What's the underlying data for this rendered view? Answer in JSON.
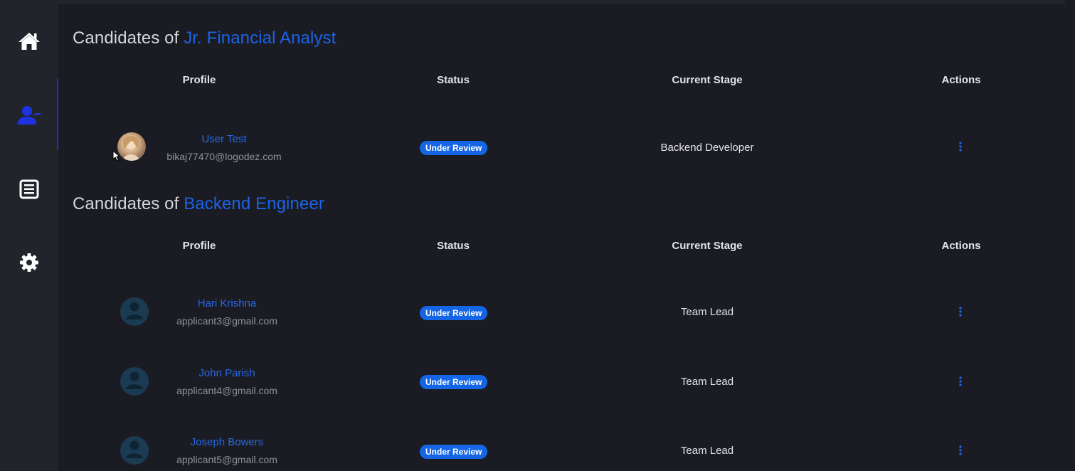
{
  "sidebar": {
    "items": [
      {
        "icon": "home-icon",
        "active": false
      },
      {
        "icon": "candidates-icon",
        "active": true
      },
      {
        "icon": "document-icon",
        "active": false
      },
      {
        "icon": "gear-icon",
        "active": false
      }
    ]
  },
  "colors": {
    "accent": "#1a63e8",
    "badge": "#1566e6",
    "background": "#1b1c23",
    "sidebar": "#22242c"
  },
  "columns": {
    "profile": "Profile",
    "status": "Status",
    "stage": "Current Stage",
    "actions": "Actions"
  },
  "sections": [
    {
      "title_prefix": "Candidates of",
      "job": "Jr. Financial Analyst",
      "candidates": [
        {
          "name": "User Test",
          "email": "bikaj77470@logodez.com",
          "status": "Under Review",
          "stage": "Backend Developer",
          "avatar": "photo"
        }
      ]
    },
    {
      "title_prefix": "Candidates of",
      "job": "Backend Engineer",
      "candidates": [
        {
          "name": "Hari Krishna",
          "email": "applicant3@gmail.com",
          "status": "Under Review",
          "stage": "Team Lead",
          "avatar": "placeholder"
        },
        {
          "name": "John Parish",
          "email": "applicant4@gmail.com",
          "status": "Under Review",
          "stage": "Team Lead",
          "avatar": "placeholder"
        },
        {
          "name": "Joseph Bowers",
          "email": "applicant5@gmail.com",
          "status": "Under Review",
          "stage": "Team Lead",
          "avatar": "placeholder"
        }
      ]
    }
  ]
}
